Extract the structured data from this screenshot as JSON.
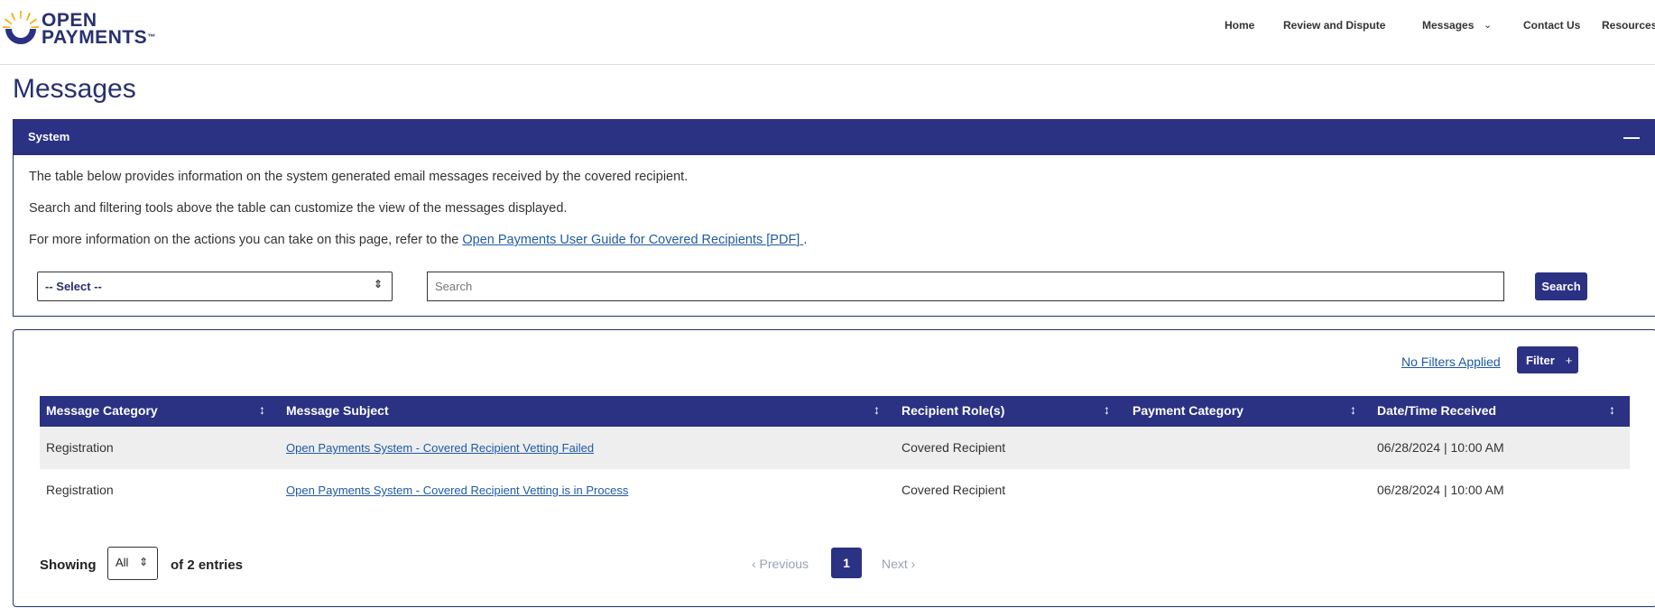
{
  "header": {
    "logo_line1": "OPEN",
    "logo_line2": "PAYMENTS",
    "logo_tm": "™",
    "nav": {
      "home": "Home",
      "review": "Review and Dispute",
      "messages": "Messages",
      "messages_chevron": "⌄",
      "contact": "Contact Us",
      "resources": "Resources"
    }
  },
  "page": {
    "title": "Messages"
  },
  "system_panel": {
    "header": "System",
    "collapse_symbol": "—",
    "line1": "The table below provides information on the system generated email messages received by the covered recipient.",
    "line2": "Search and filtering tools above the table can customize the view of the messages displayed.",
    "line3_prefix": "For more information on the actions you can take on this page, refer to the ",
    "line3_link": "Open Payments User Guide for Covered Recipients [PDF] ",
    "line3_suffix": ".",
    "select_value": "-- Select --",
    "search_placeholder": "Search",
    "search_button": "Search"
  },
  "table_panel": {
    "no_filters": "No Filters Applied",
    "filter_button": "Filter",
    "filter_plus": "+",
    "columns": [
      "Message Category",
      "Message Subject",
      "Recipient Role(s)",
      "Payment Category",
      "Date/Time Received"
    ],
    "sort_symbol": "↕",
    "rows": [
      {
        "category": "Registration",
        "subject": "Open Payments System - Covered Recipient Vetting Failed",
        "role": "Covered Recipient",
        "payment_category": "",
        "received": "06/28/2024 | 10:00 AM"
      },
      {
        "category": "Registration",
        "subject": "Open Payments System - Covered Recipient Vetting is in Process",
        "role": "Covered Recipient",
        "payment_category": "",
        "received": "06/28/2024 | 10:00 AM"
      }
    ],
    "footer": {
      "showing": "Showing",
      "page_size": "All",
      "of_entries": "of 2 entries",
      "previous": "‹ Previous",
      "current_page": "1",
      "next": "Next ›"
    }
  },
  "colors": {
    "brand_navy": "#2b3183",
    "link_blue": "#1f5aa6",
    "logo_yellow": "#f2b21b"
  },
  "icons": {
    "logo": "sunburst-logo-icon",
    "sort": "sort-arrows-icon",
    "collapse": "minus-icon",
    "select_caret": "up-down-caret-icon"
  }
}
